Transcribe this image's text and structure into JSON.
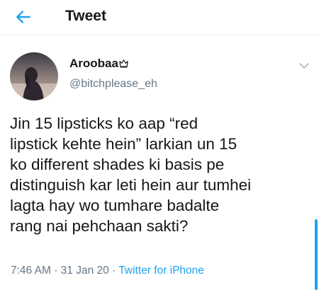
{
  "header": {
    "title": "Tweet",
    "back_icon": "arrow-left-icon"
  },
  "tweet": {
    "author_name": "Aroobaa",
    "author_badge_icon": "crown-icon",
    "author_handle": "@bitchplease_eh",
    "menu_icon": "chevron-down-icon",
    "text_lines": [
      "Jin 15 lipsticks ko aap “red",
      "lipstick kehte hein” larkian un 15",
      "ko different shades ki basis pe",
      "distinguish kar leti hein aur tumhei",
      "lagta hay wo tumhare badalte",
      "rang nai pehchaan sakti?"
    ],
    "time": "7:46 AM",
    "separator": "·",
    "date": "31 Jan 20",
    "source": "Twitter for iPhone"
  },
  "colors": {
    "accent": "#1da1f2",
    "secondary_text": "#657786",
    "primary_text": "#14171a"
  }
}
